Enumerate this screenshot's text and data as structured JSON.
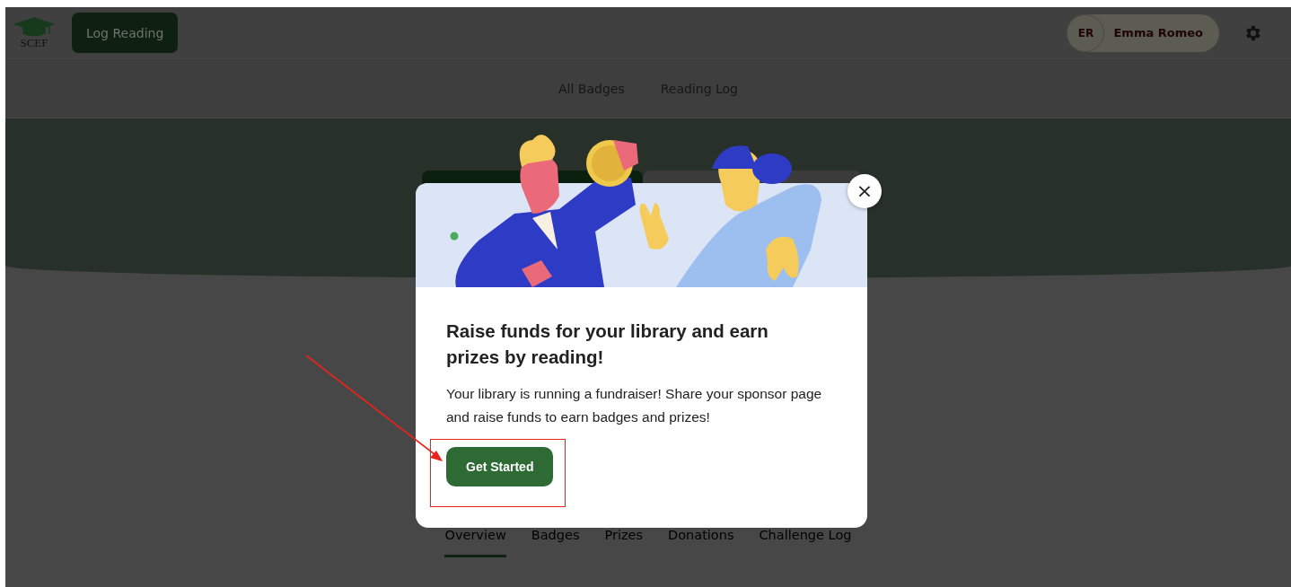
{
  "header": {
    "logo_text": "SCEF",
    "log_button": "Log Reading",
    "user": {
      "initials": "ER",
      "name": "Emma Romeo"
    }
  },
  "nav": [
    {
      "label": "All Badges",
      "selected": false
    },
    {
      "label": "Reading Log",
      "selected": false
    }
  ],
  "tabs": [
    {
      "label": "Overview",
      "selected": true
    },
    {
      "label": "Badges",
      "selected": false
    },
    {
      "label": "Prizes",
      "selected": false
    },
    {
      "label": "Donations",
      "selected": false
    },
    {
      "label": "Challenge Log",
      "selected": false
    }
  ],
  "modal": {
    "title": "Raise funds for your library and earn prizes by reading!",
    "body": "Your library is running a fundraiser! Share your sponsor page and raise funds to earn badges and prizes!",
    "button": "Get Started",
    "close": "×"
  }
}
